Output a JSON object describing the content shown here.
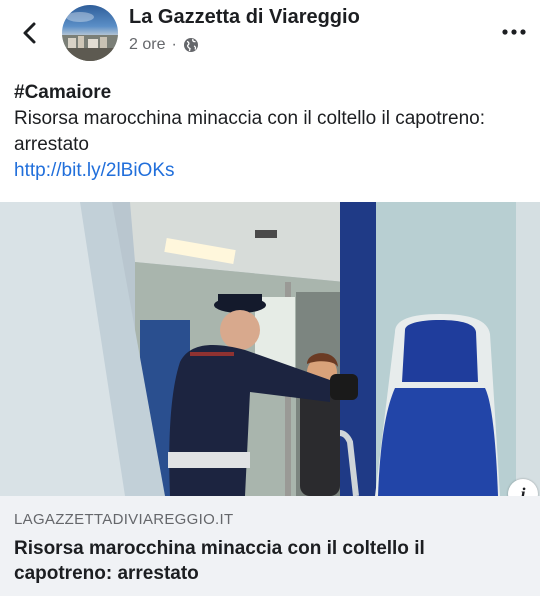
{
  "header": {
    "page_name": "La Gazzetta di Viareggio",
    "time": "2 ore",
    "separator": "·",
    "back_icon": "chevron-left-icon",
    "privacy_icon": "globe-icon",
    "more_icon": "more-horizontal-icon"
  },
  "post": {
    "hashtag": "#Camaiore",
    "text": "Risorsa marocchina minaccia con il coltello il capotreno: arrestato",
    "link": "http://bit.ly/2lBiOKs"
  },
  "link_preview": {
    "domain": "LAGAZZETTADIVIAREGGIO.IT",
    "title": "Risorsa marocchina minaccia con il coltello il capotreno: arrestato",
    "info_label": "i",
    "background": "#f0f2f5"
  },
  "colors": {
    "link": "#216fdb",
    "secondary_text": "#65676b",
    "seat_blue": "#1f3d9c"
  }
}
